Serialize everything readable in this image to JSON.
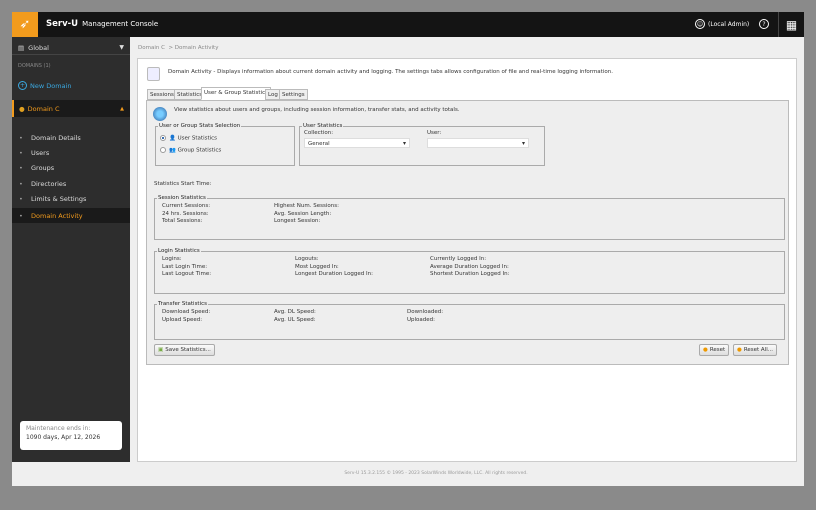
{
  "header": {
    "brand": "Serv-U",
    "subtitle": "Management Console",
    "user": "(Local Admin)",
    "help": "?"
  },
  "sidebar": {
    "global": "Global",
    "domains_heading": "DOMAINS (1)",
    "new_domain": "New Domain",
    "domain": "Domain C",
    "items": [
      {
        "label": "Domain Details"
      },
      {
        "label": "Users"
      },
      {
        "label": "Groups"
      },
      {
        "label": "Directories"
      },
      {
        "label": "Limits & Settings"
      },
      {
        "label": "Domain Activity"
      }
    ],
    "maintenance_label": "Maintenance ends in:",
    "maintenance_value": "1090 days, Apr 12, 2026"
  },
  "breadcrumb": {
    "parent": "Domain C",
    "sep": ">",
    "current": "Domain Activity"
  },
  "page": {
    "description": "Domain Activity - Displays information about current domain activity and logging. The settings tabs allows configuration of file and real-time logging information.",
    "tabs": [
      {
        "label": "Sessions"
      },
      {
        "label": "Statistics"
      },
      {
        "label": "User & Group Statistics"
      },
      {
        "label": "Log"
      },
      {
        "label": "Settings"
      }
    ],
    "intro": "View statistics about users and groups, including session information, transfer stats, and activity totals.",
    "selection": {
      "legend": "User or Group Stats Selection",
      "user": "User Statistics",
      "group": "Group Statistics"
    },
    "user_stats": {
      "legend": "User Statistics",
      "collection_label": "Collection:",
      "collection_value": "General",
      "user_label": "User:",
      "user_value": ""
    },
    "start_time": "Statistics Start Time:",
    "session": {
      "legend": "Session Statistics",
      "cols": [
        [
          "Current Sessions:",
          "24 hrs. Sessions:",
          "Total Sessions:"
        ],
        [
          "Highest Num. Sessions:",
          "Avg. Session Length:",
          "Longest Session:"
        ]
      ]
    },
    "login": {
      "legend": "Login Statistics",
      "cols": [
        [
          "Logins:",
          "Last Login Time:",
          "Last Logout Time:"
        ],
        [
          "Logouts:",
          "Most Logged In:",
          "Longest Duration Logged In:"
        ],
        [
          "Currently Logged In:",
          "Average Duration Logged In:",
          "Shortest Duration Logged In:"
        ]
      ]
    },
    "transfer": {
      "legend": "Transfer Statistics",
      "cols": [
        [
          "Download Speed:",
          "Upload Speed:"
        ],
        [
          "Avg. DL Speed:",
          "Avg. UL Speed:"
        ],
        [
          "Downloaded:",
          "Uploaded:"
        ]
      ]
    },
    "buttons": {
      "save": "Save Statistics...",
      "reset": "Reset",
      "reset_all": "Reset All..."
    }
  },
  "footer": "Serv-U 15.3.2.155 © 1995 - 2023 SolarWinds Worldwide, LLC. All rights reserved.",
  "colors": {
    "accent": "#f29b1d",
    "sidebar": "#2d2d2d",
    "header": "#141414",
    "link": "#3aa8e0"
  }
}
